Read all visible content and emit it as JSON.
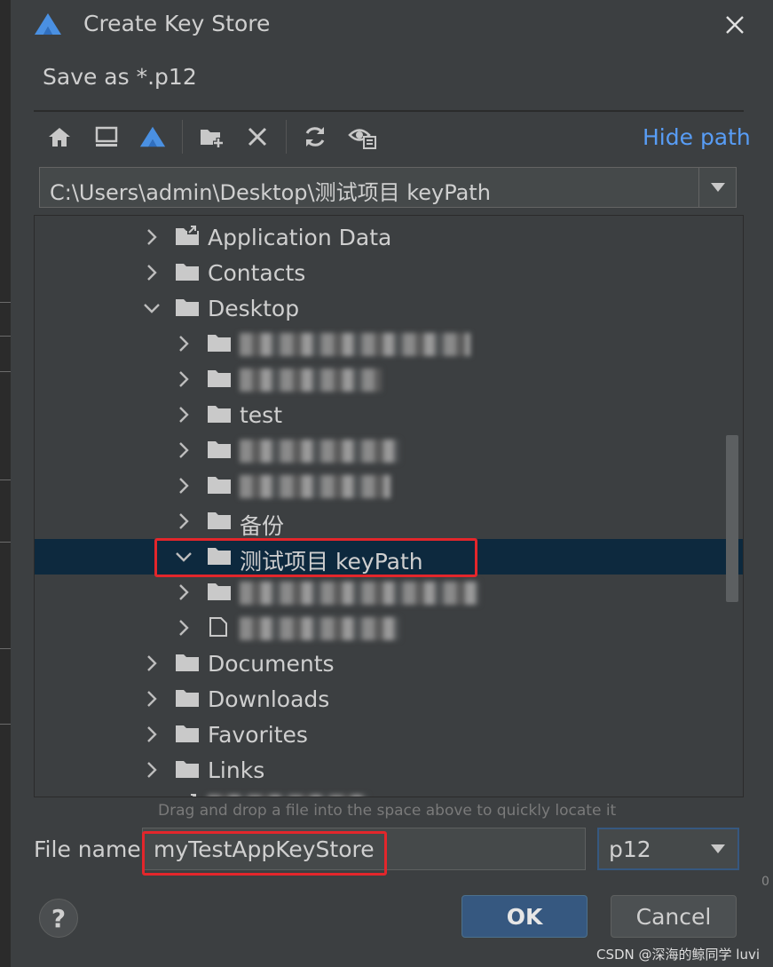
{
  "dialog": {
    "title": "Create Key Store",
    "subtitle": "Save as *.p12"
  },
  "toolbar": {
    "buttons": [
      {
        "name": "home-icon"
      },
      {
        "name": "desktop-icon"
      },
      {
        "name": "project-icon"
      },
      {
        "name": "new-folder-icon"
      },
      {
        "name": "delete-icon"
      },
      {
        "name": "refresh-icon"
      },
      {
        "name": "show-hidden-icon"
      }
    ],
    "hide_path_label": "Hide path"
  },
  "path": {
    "value": "C:\\Users\\admin\\Desktop\\测试项目 keyPath"
  },
  "tree": {
    "rows": [
      {
        "label": "Application Data",
        "expanded": false,
        "level": 0,
        "icon": "folder-shortcut-icon"
      },
      {
        "label": "Contacts",
        "expanded": false,
        "level": 0,
        "icon": "folder-icon"
      },
      {
        "label": "Desktop",
        "expanded": true,
        "level": 0,
        "icon": "folder-icon"
      },
      {
        "label": "",
        "expanded": false,
        "level": 1,
        "icon": "folder-icon",
        "obscured": true
      },
      {
        "label": "",
        "expanded": false,
        "level": 1,
        "icon": "folder-icon",
        "obscured": true
      },
      {
        "label": "test",
        "expanded": false,
        "level": 1,
        "icon": "folder-icon"
      },
      {
        "label": "",
        "expanded": false,
        "level": 1,
        "icon": "folder-icon",
        "obscured": true
      },
      {
        "label": "",
        "expanded": false,
        "level": 1,
        "icon": "folder-icon",
        "obscured": true
      },
      {
        "label": "备份",
        "expanded": false,
        "level": 1,
        "icon": "folder-icon"
      },
      {
        "label": "测试项目 keyPath",
        "expanded": true,
        "level": 1,
        "icon": "folder-icon",
        "selected": true
      },
      {
        "label": "",
        "expanded": false,
        "level": 1,
        "icon": "folder-icon",
        "obscured": true
      },
      {
        "label": "",
        "expanded": false,
        "level": 1,
        "icon": "file-icon",
        "obscured": true
      },
      {
        "label": "Documents",
        "expanded": false,
        "level": 0,
        "icon": "folder-icon"
      },
      {
        "label": "Downloads",
        "expanded": false,
        "level": 0,
        "icon": "folder-icon"
      },
      {
        "label": "Favorites",
        "expanded": false,
        "level": 0,
        "icon": "folder-icon"
      },
      {
        "label": "Links",
        "expanded": false,
        "level": 0,
        "icon": "folder-icon"
      },
      {
        "label": "",
        "expanded": false,
        "level": 0,
        "icon": "folder-shortcut-icon",
        "obscured": true
      }
    ]
  },
  "hint": "Drag and drop a file into the space above to quickly locate it",
  "filename": {
    "label": "File name:",
    "value": "myTestAppKeyStore"
  },
  "extension": {
    "selected": "p12"
  },
  "buttons": {
    "help": "?",
    "ok": "OK",
    "cancel": "Cancel"
  },
  "watermark": "CSDN @深海的鲸同学 luvi",
  "colors": {
    "background": "#3c3f41",
    "selection": "#0d293e",
    "link": "#589df6",
    "primary_button": "#365880",
    "highlight_box": "#e3262b"
  }
}
